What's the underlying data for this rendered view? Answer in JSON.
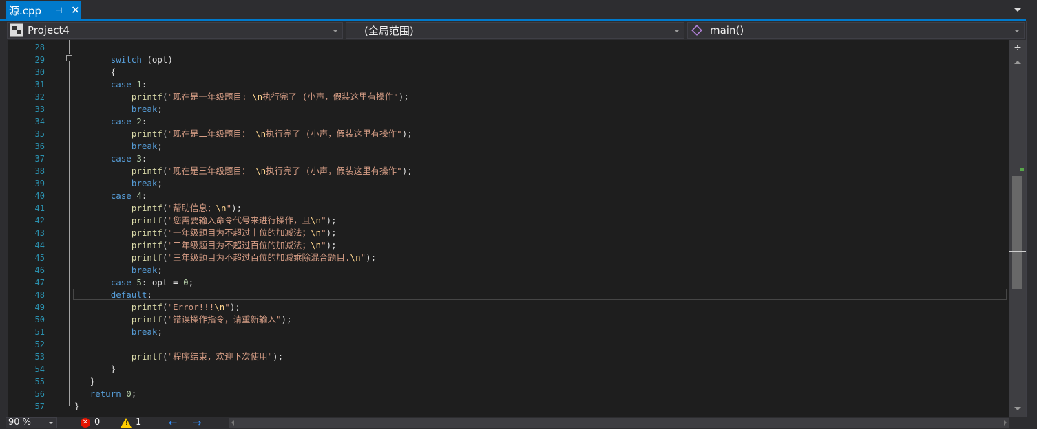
{
  "tab": {
    "title": "源.cpp",
    "pin": "⊣",
    "close": "✕"
  },
  "navbar": {
    "project": "Project4",
    "scope": "(全局范围)",
    "member": "main()"
  },
  "status": {
    "zoom": "90 %",
    "errors": "0",
    "warnings": "1",
    "back": "←",
    "forward": "→"
  },
  "editor": {
    "lines": [
      {
        "n": "28",
        "html": ""
      },
      {
        "n": "29",
        "html": "       <span class=\"kw\">switch</span> (opt)"
      },
      {
        "n": "30",
        "html": "       {"
      },
      {
        "n": "31",
        "html": "       <span class=\"kw\">case</span> <span class=\"num\">1</span>:"
      },
      {
        "n": "32",
        "html": "           <span class=\"fn\">printf</span>(<span class=\"str\">\"现在是一年级题目: <span class=\"esc\">\\n</span>执行完了 (小声，假装这里有操作\"</span>);"
      },
      {
        "n": "33",
        "html": "           <span class=\"kw\">break</span>;"
      },
      {
        "n": "34",
        "html": "       <span class=\"kw\">case</span> <span class=\"num\">2</span>:"
      },
      {
        "n": "35",
        "html": "           <span class=\"fn\">printf</span>(<span class=\"str\">\"现在是二年级题目： <span class=\"esc\">\\n</span>执行完了 (小声，假装这里有操作\"</span>);"
      },
      {
        "n": "36",
        "html": "           <span class=\"kw\">break</span>;"
      },
      {
        "n": "37",
        "html": "       <span class=\"kw\">case</span> <span class=\"num\">3</span>:"
      },
      {
        "n": "38",
        "html": "           <span class=\"fn\">printf</span>(<span class=\"str\">\"现在是三年级题目： <span class=\"esc\">\\n</span>执行完了 (小声，假装这里有操作\"</span>);"
      },
      {
        "n": "39",
        "html": "           <span class=\"kw\">break</span>;"
      },
      {
        "n": "40",
        "html": "       <span class=\"kw\">case</span> <span class=\"num\">4</span>:"
      },
      {
        "n": "41",
        "html": "           <span class=\"fn\">printf</span>(<span class=\"str\">\"帮助信息：<span class=\"esc\">\\n</span>\"</span>);"
      },
      {
        "n": "42",
        "html": "           <span class=\"fn\">printf</span>(<span class=\"str\">\"您需要输入命令代号来进行操作，且<span class=\"esc\">\\n</span>\"</span>);"
      },
      {
        "n": "43",
        "html": "           <span class=\"fn\">printf</span>(<span class=\"str\">\"一年级题目为不超过十位的加减法；<span class=\"esc\">\\n</span>\"</span>);"
      },
      {
        "n": "44",
        "html": "           <span class=\"fn\">printf</span>(<span class=\"str\">\"二年级题目为不超过百位的加减法；<span class=\"esc\">\\n</span>\"</span>);"
      },
      {
        "n": "45",
        "html": "           <span class=\"fn\">printf</span>(<span class=\"str\">\"三年级题目为不超过百位的加减乘除混合题目.<span class=\"esc\">\\n</span>\"</span>);"
      },
      {
        "n": "46",
        "html": "           <span class=\"kw\">break</span>;"
      },
      {
        "n": "47",
        "html": "       <span class=\"kw\">case</span> <span class=\"num\">5</span>: opt = <span class=\"num\">0</span>;"
      },
      {
        "n": "48",
        "html": "       <span class=\"kw\">default</span>:"
      },
      {
        "n": "49",
        "html": "           <span class=\"fn\">printf</span>(<span class=\"str\">\"Error!!!<span class=\"esc\">\\n</span>\"</span>);"
      },
      {
        "n": "50",
        "html": "           <span class=\"fn\">printf</span>(<span class=\"str\">\"错误操作指令，请重新输入\"</span>);"
      },
      {
        "n": "51",
        "html": "           <span class=\"kw\">break</span>;"
      },
      {
        "n": "52",
        "html": ""
      },
      {
        "n": "53",
        "html": "           <span class=\"fn\">printf</span>(<span class=\"str\">\"程序结束，欢迎下次使用\"</span>);"
      },
      {
        "n": "54",
        "html": "       }"
      },
      {
        "n": "55",
        "html": "   }"
      },
      {
        "n": "56",
        "html": "   <span class=\"kw\">return</span> <span class=\"num\">0</span>;"
      },
      {
        "n": "57",
        "html": "}"
      }
    ]
  }
}
